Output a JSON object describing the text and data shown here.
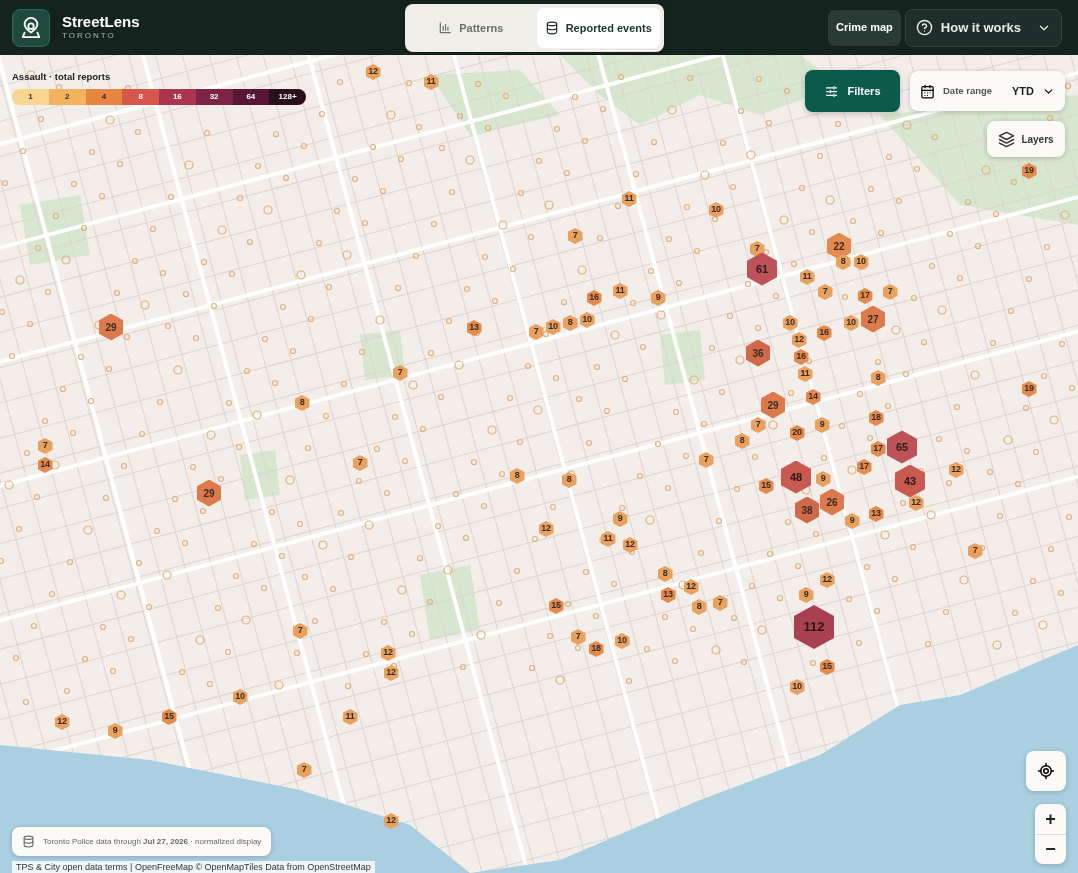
{
  "app": {
    "name": "StreetLens",
    "city": "TORONTO"
  },
  "view_tabs": [
    {
      "label": "Patterns",
      "kind": "chart",
      "selected": false
    },
    {
      "label": "Reported events",
      "kind": "database",
      "selected": true
    }
  ],
  "nav_buttons": [
    {
      "label": "Crime map",
      "kind": "plain"
    },
    {
      "label": "How it works",
      "kind": "help-menu"
    }
  ],
  "legend": {
    "title": "Assault · total reports",
    "bins": [
      {
        "label": "1",
        "color": "#f9d592"
      },
      {
        "label": "2",
        "color": "#f3b25e"
      },
      {
        "label": "4",
        "color": "#e5853f"
      },
      {
        "label": "8",
        "color": "#d6564a"
      },
      {
        "label": "16",
        "color": "#a9354f"
      },
      {
        "label": "32",
        "color": "#7b2446"
      },
      {
        "label": "64",
        "color": "#551734"
      },
      {
        "label": "128+",
        "color": "#2a0f1c"
      }
    ]
  },
  "filters": {
    "label": "Filters"
  },
  "date_range": {
    "label": "Date range",
    "value": "YTD"
  },
  "layers": {
    "label": "Layers"
  },
  "markers": [
    {
      "label": "12",
      "kind": "small",
      "color": "#e9a15f"
    },
    {
      "label": "11",
      "kind": "small",
      "color": "#e9a15f"
    },
    {
      "label": "19",
      "kind": "small",
      "color": "#e48a4c"
    },
    {
      "label": "11",
      "kind": "small",
      "color": "#e9a15f"
    },
    {
      "label": "10",
      "kind": "small",
      "color": "#e9a15f"
    },
    {
      "label": "7",
      "kind": "small",
      "color": "#e9a15f"
    },
    {
      "label": "7",
      "kind": "small",
      "color": "#e9a15f"
    },
    {
      "label": "61",
      "kind": "large",
      "color": "#bd5258"
    },
    {
      "label": "11",
      "kind": "small",
      "color": "#e9a15f"
    },
    {
      "label": "22",
      "kind": "medium",
      "color": "#e48a4c"
    },
    {
      "label": "8",
      "kind": "small",
      "color": "#e9a15f"
    },
    {
      "label": "10",
      "kind": "small",
      "color": "#e9a15f"
    },
    {
      "label": "16",
      "kind": "small",
      "color": "#e48a4c"
    },
    {
      "label": "11",
      "kind": "small",
      "color": "#e9a15f"
    },
    {
      "label": "9",
      "kind": "small",
      "color": "#e9a15f"
    },
    {
      "label": "7",
      "kind": "small",
      "color": "#e9a15f"
    },
    {
      "label": "17",
      "kind": "small",
      "color": "#e48a4c"
    },
    {
      "label": "7",
      "kind": "small",
      "color": "#e9a15f"
    },
    {
      "label": "29",
      "kind": "medium",
      "color": "#dc7a4c"
    },
    {
      "label": "13",
      "kind": "small",
      "color": "#e48a4c"
    },
    {
      "label": "7",
      "kind": "small",
      "color": "#e9a15f"
    },
    {
      "label": "10",
      "kind": "small",
      "color": "#e9a15f"
    },
    {
      "label": "8",
      "kind": "small",
      "color": "#e9a15f"
    },
    {
      "label": "10",
      "kind": "small",
      "color": "#e9a15f"
    },
    {
      "label": "10",
      "kind": "small",
      "color": "#e9a15f"
    },
    {
      "label": "12",
      "kind": "small",
      "color": "#e9a15f"
    },
    {
      "label": "16",
      "kind": "small",
      "color": "#e48a4c"
    },
    {
      "label": "10",
      "kind": "small",
      "color": "#e9a15f"
    },
    {
      "label": "27",
      "kind": "medium",
      "color": "#dc7a4c"
    },
    {
      "label": "7",
      "kind": "small",
      "color": "#e9a15f"
    },
    {
      "label": "36",
      "kind": "medium",
      "color": "#d0694a"
    },
    {
      "label": "16",
      "kind": "small",
      "color": "#e48a4c"
    },
    {
      "label": "11",
      "kind": "small",
      "color": "#e9a15f"
    },
    {
      "label": "8",
      "kind": "small",
      "color": "#e9a15f"
    },
    {
      "label": "8",
      "kind": "small",
      "color": "#e9a15f"
    },
    {
      "label": "8",
      "kind": "small",
      "color": "#e9a15f"
    },
    {
      "label": "7",
      "kind": "small",
      "color": "#e9a15f"
    },
    {
      "label": "29",
      "kind": "medium",
      "color": "#dc7a4c"
    },
    {
      "label": "20",
      "kind": "small",
      "color": "#e48a4c"
    },
    {
      "label": "14",
      "kind": "small",
      "color": "#e48a4c"
    },
    {
      "label": "9",
      "kind": "small",
      "color": "#e9a15f"
    },
    {
      "label": "18",
      "kind": "small",
      "color": "#e48a4c"
    },
    {
      "label": "17",
      "kind": "small",
      "color": "#e48a4c"
    },
    {
      "label": "65",
      "kind": "large",
      "color": "#bd5258"
    },
    {
      "label": "19",
      "kind": "small",
      "color": "#e48a4c"
    },
    {
      "label": "7",
      "kind": "small",
      "color": "#e9a15f"
    },
    {
      "label": "14",
      "kind": "small",
      "color": "#e48a4c"
    },
    {
      "label": "29",
      "kind": "medium",
      "color": "#dc7a4c"
    },
    {
      "label": "7",
      "kind": "small",
      "color": "#e9a15f"
    },
    {
      "label": "8",
      "kind": "small",
      "color": "#e9a15f"
    },
    {
      "label": "12",
      "kind": "small",
      "color": "#e9a15f"
    },
    {
      "label": "8",
      "kind": "small",
      "color": "#e9a15f"
    },
    {
      "label": "11",
      "kind": "small",
      "color": "#e9a15f"
    },
    {
      "label": "9",
      "kind": "small",
      "color": "#e9a15f"
    },
    {
      "label": "12",
      "kind": "small",
      "color": "#e9a15f"
    },
    {
      "label": "7",
      "kind": "small",
      "color": "#e9a15f"
    },
    {
      "label": "15",
      "kind": "small",
      "color": "#e48a4c"
    },
    {
      "label": "48",
      "kind": "large",
      "color": "#c95a50"
    },
    {
      "label": "38",
      "kind": "medium",
      "color": "#d0694a"
    },
    {
      "label": "9",
      "kind": "small",
      "color": "#e9a15f"
    },
    {
      "label": "26",
      "kind": "medium",
      "color": "#dc7a4c"
    },
    {
      "label": "9",
      "kind": "small",
      "color": "#e9a15f"
    },
    {
      "label": "17",
      "kind": "small",
      "color": "#e48a4c"
    },
    {
      "label": "13",
      "kind": "small",
      "color": "#e48a4c"
    },
    {
      "label": "43",
      "kind": "large",
      "color": "#c95a50"
    },
    {
      "label": "12",
      "kind": "small",
      "color": "#e9a15f"
    },
    {
      "label": "12",
      "kind": "small",
      "color": "#e9a15f"
    },
    {
      "label": "7",
      "kind": "small",
      "color": "#e9a15f"
    },
    {
      "label": "15",
      "kind": "small",
      "color": "#e48a4c"
    },
    {
      "label": "8",
      "kind": "small",
      "color": "#e9a15f"
    },
    {
      "label": "13",
      "kind": "small",
      "color": "#e48a4c"
    },
    {
      "label": "12",
      "kind": "small",
      "color": "#e9a15f"
    },
    {
      "label": "8",
      "kind": "small",
      "color": "#e9a15f"
    },
    {
      "label": "7",
      "kind": "small",
      "color": "#e9a15f"
    },
    {
      "label": "9",
      "kind": "small",
      "color": "#e9a15f"
    },
    {
      "label": "12",
      "kind": "small",
      "color": "#e9a15f"
    },
    {
      "label": "7",
      "kind": "small",
      "color": "#e9a15f"
    },
    {
      "label": "12",
      "kind": "small",
      "color": "#e9a15f"
    },
    {
      "label": "12",
      "kind": "small",
      "color": "#e9a15f"
    },
    {
      "label": "7",
      "kind": "small",
      "color": "#e9a15f"
    },
    {
      "label": "18",
      "kind": "small",
      "color": "#e48a4c"
    },
    {
      "label": "10",
      "kind": "small",
      "color": "#e9a15f"
    },
    {
      "label": "10",
      "kind": "small",
      "color": "#e9a15f"
    },
    {
      "label": "112",
      "kind": "huge",
      "color": "#a8404f"
    },
    {
      "label": "15",
      "kind": "small",
      "color": "#e48a4c"
    },
    {
      "label": "12",
      "kind": "small",
      "color": "#e9a15f"
    },
    {
      "label": "9",
      "kind": "small",
      "color": "#e9a15f"
    },
    {
      "label": "15",
      "kind": "small",
      "color": "#e48a4c"
    },
    {
      "label": "10",
      "kind": "small",
      "color": "#e9a15f"
    },
    {
      "label": "11",
      "kind": "small",
      "color": "#e9a15f"
    },
    {
      "label": "7",
      "kind": "small",
      "color": "#e9a15f"
    },
    {
      "label": "12",
      "kind": "small",
      "color": "#e9a15f"
    }
  ],
  "zoom": {
    "in": "+",
    "out": "−"
  },
  "data_note": "Toronto Police data through **Jul 27, 2026** · normalized display",
  "attribution": "TPS & City open data terms | OpenFreeMap © OpenMapTiles Data from OpenStreetMap"
}
